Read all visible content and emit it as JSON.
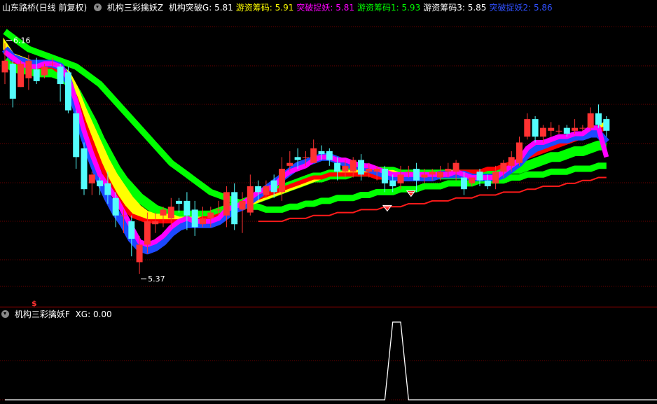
{
  "main_header": {
    "symbol": "山东路桥(日线 前复权)",
    "indicator": "机构三彩擒妖Z",
    "items": [
      {
        "label": "机构突破G:",
        "value": "5.81",
        "color": "#ffffff"
      },
      {
        "label": "游资筹码:",
        "value": "5.91",
        "color": "#ffff00"
      },
      {
        "label": "突破捉妖:",
        "value": "5.81",
        "color": "#ff00ff"
      },
      {
        "label": "游资筹码1:",
        "value": "5.93",
        "color": "#00ff00"
      },
      {
        "label": "游资筹码3:",
        "value": "5.85",
        "color": "#ffffff"
      },
      {
        "label": "突破捉妖2:",
        "value": "5.86",
        "color": "#3050ff"
      }
    ]
  },
  "sub_header": {
    "indicator": "机构三彩擒妖F",
    "items": [
      {
        "label": "XG:",
        "value": "0.00",
        "color": "#ffffff"
      }
    ]
  },
  "annotations": {
    "high_label": "6.16",
    "low_label": "5.37",
    "marker_glyph": "$"
  },
  "colors": {
    "up": "#ff3232",
    "down": "#54fcfc",
    "grid": "#6e0000",
    "blue_band": "#1c49ff",
    "green_band": "#00ff00",
    "magenta": "#ff00ff",
    "yellow": "#ffff00",
    "red_band": "#ff0000",
    "red_line": "#ff1a1a",
    "signal": "#ffffff"
  },
  "chart_data": [
    {
      "type": "candlestick",
      "title": "山东路桥(日线 前复权)",
      "ylim": [
        5.3,
        6.3
      ],
      "grid": true,
      "candles": [
        [
          6.1,
          6.14,
          6.2,
          6.06
        ],
        [
          6.13,
          6.01,
          6.14,
          5.98
        ],
        [
          6.05,
          6.13,
          6.14,
          6.05
        ],
        [
          6.08,
          6.14,
          6.16,
          6.04
        ],
        [
          6.11,
          6.07,
          6.15,
          6.06
        ],
        [
          6.09,
          6.12,
          6.13,
          6.08
        ],
        [
          6.13,
          6.13,
          6.15,
          6.12
        ],
        [
          6.12,
          6.06,
          6.13,
          6.0
        ],
        [
          6.1,
          5.97,
          6.12,
          5.96
        ],
        [
          5.96,
          5.81,
          5.97,
          5.77
        ],
        [
          5.84,
          5.7,
          5.86,
          5.68
        ],
        [
          5.72,
          5.75,
          5.76,
          5.68
        ],
        [
          5.73,
          5.71,
          5.74,
          5.68
        ],
        [
          5.72,
          5.68,
          5.76,
          5.65
        ],
        [
          5.67,
          5.61,
          5.69,
          5.57
        ],
        [
          5.61,
          5.61,
          5.63,
          5.55
        ],
        [
          5.59,
          5.53,
          5.61,
          5.47
        ],
        [
          5.45,
          5.51,
          5.54,
          5.41
        ],
        [
          5.51,
          5.59,
          5.62,
          5.48
        ],
        [
          5.58,
          5.59,
          5.62,
          5.55
        ],
        [
          5.61,
          5.63,
          5.64,
          5.57
        ],
        [
          5.6,
          5.64,
          5.67,
          5.57
        ],
        [
          5.66,
          5.65,
          5.67,
          5.62
        ],
        [
          5.66,
          5.61,
          5.69,
          5.56
        ],
        [
          5.63,
          5.57,
          5.66,
          5.54
        ],
        [
          5.58,
          5.6,
          5.64,
          5.57
        ],
        [
          5.6,
          5.62,
          5.64,
          5.57
        ],
        [
          5.63,
          5.63,
          5.66,
          5.61
        ],
        [
          5.61,
          5.69,
          5.71,
          5.57
        ],
        [
          5.69,
          5.58,
          5.72,
          5.56
        ],
        [
          5.63,
          5.66,
          5.69,
          5.55
        ],
        [
          5.62,
          5.71,
          5.75,
          5.61
        ],
        [
          5.71,
          5.69,
          5.73,
          5.66
        ],
        [
          5.68,
          5.71,
          5.73,
          5.67
        ],
        [
          5.73,
          5.69,
          5.75,
          5.67
        ],
        [
          5.69,
          5.77,
          5.81,
          5.66
        ],
        [
          5.78,
          5.79,
          5.83,
          5.76
        ],
        [
          5.81,
          5.8,
          5.84,
          5.77
        ],
        [
          5.81,
          5.81,
          5.83,
          5.78
        ],
        [
          5.79,
          5.84,
          5.87,
          5.79
        ],
        [
          5.83,
          5.82,
          5.85,
          5.8
        ],
        [
          5.83,
          5.8,
          5.84,
          5.78
        ],
        [
          5.79,
          5.76,
          5.81,
          5.73
        ],
        [
          5.76,
          5.78,
          5.8,
          5.74
        ],
        [
          5.76,
          5.8,
          5.81,
          5.74
        ],
        [
          5.8,
          5.75,
          5.82,
          5.73
        ],
        [
          5.76,
          5.77,
          5.79,
          5.74
        ],
        [
          5.76,
          5.77,
          5.78,
          5.73
        ],
        [
          5.77,
          5.72,
          5.78,
          5.69
        ],
        [
          5.73,
          5.71,
          5.75,
          5.69
        ],
        [
          5.72,
          5.75,
          5.78,
          5.7
        ],
        [
          5.76,
          5.76,
          5.78,
          5.74
        ],
        [
          5.77,
          5.73,
          5.79,
          5.69
        ],
        [
          5.74,
          5.75,
          5.77,
          5.72
        ],
        [
          5.75,
          5.76,
          5.77,
          5.73
        ],
        [
          5.74,
          5.76,
          5.78,
          5.73
        ],
        [
          5.76,
          5.77,
          5.79,
          5.74
        ],
        [
          5.76,
          5.79,
          5.8,
          5.73
        ],
        [
          5.74,
          5.7,
          5.76,
          5.68
        ],
        [
          5.72,
          5.74,
          5.74,
          5.71
        ],
        [
          5.76,
          5.73,
          5.77,
          5.71
        ],
        [
          5.73,
          5.71,
          5.75,
          5.7
        ],
        [
          5.72,
          5.76,
          5.78,
          5.7
        ],
        [
          5.76,
          5.79,
          5.8,
          5.74
        ],
        [
          5.78,
          5.81,
          5.83,
          5.76
        ],
        [
          5.79,
          5.86,
          5.88,
          5.78
        ],
        [
          5.88,
          5.94,
          5.96,
          5.87
        ],
        [
          5.94,
          5.88,
          5.95,
          5.86
        ],
        [
          5.88,
          5.91,
          5.92,
          5.86
        ],
        [
          5.9,
          5.91,
          5.93,
          5.88
        ],
        [
          5.9,
          5.9,
          5.92,
          5.89
        ],
        [
          5.91,
          5.89,
          5.92,
          5.88
        ],
        [
          5.9,
          5.91,
          5.94,
          5.89
        ],
        [
          5.91,
          5.91,
          5.92,
          5.9
        ],
        [
          5.91,
          5.96,
          5.98,
          5.9
        ],
        [
          5.96,
          5.92,
          5.99,
          5.91
        ],
        [
          5.94,
          5.9,
          5.95,
          5.88
        ]
      ],
      "series": [
        {
          "name": "机构突破G",
          "values": [
            6.24,
            6.22,
            6.2,
            6.18,
            6.17,
            6.16,
            6.15,
            6.14,
            6.13,
            6.12,
            6.1,
            6.08,
            6.06,
            6.03,
            6.0,
            5.97,
            5.94,
            5.91,
            5.88,
            5.85,
            5.82,
            5.79,
            5.77,
            5.75,
            5.73,
            5.71,
            5.69,
            5.68,
            5.67,
            5.66,
            5.65,
            5.64,
            5.64,
            5.63,
            5.63,
            5.63,
            5.64,
            5.64,
            5.65,
            5.65,
            5.66,
            5.66,
            5.67,
            5.67,
            5.67,
            5.68,
            5.68,
            5.69,
            5.69,
            5.69,
            5.7,
            5.7,
            5.7,
            5.71,
            5.71,
            5.71,
            5.72,
            5.72,
            5.72,
            5.72,
            5.73,
            5.73,
            5.73,
            5.73,
            5.74,
            5.74,
            5.75,
            5.75,
            5.75,
            5.76,
            5.76,
            5.76,
            5.77,
            5.77,
            5.77,
            5.78,
            5.78
          ]
        },
        {
          "name": "游资筹码1",
          "values": [
            6.2,
            6.16,
            6.15,
            6.14,
            6.13,
            6.13,
            6.13,
            6.12,
            6.1,
            6.05,
            5.98,
            5.92,
            5.86,
            5.8,
            5.75,
            5.71,
            5.67,
            5.64,
            5.62,
            5.61,
            5.61,
            5.61,
            5.6,
            5.6,
            5.6,
            5.6,
            5.6,
            5.61,
            5.62,
            5.63,
            5.64,
            5.65,
            5.66,
            5.67,
            5.68,
            5.69,
            5.7,
            5.71,
            5.72,
            5.73,
            5.74,
            5.75,
            5.75,
            5.76,
            5.76,
            5.76,
            5.76,
            5.76,
            5.76,
            5.76,
            5.75,
            5.75,
            5.75,
            5.75,
            5.75,
            5.75,
            5.76,
            5.76,
            5.76,
            5.76,
            5.76,
            5.77,
            5.77,
            5.78,
            5.79,
            5.8,
            5.82,
            5.83,
            5.84,
            5.85,
            5.86,
            5.87,
            5.88,
            5.89,
            5.9,
            5.91,
            5.93
          ]
        },
        {
          "name": "游资筹码",
          "values": [
            6.18,
            6.14,
            6.13,
            6.12,
            6.12,
            6.12,
            6.12,
            6.1,
            6.07,
            6.01,
            5.93,
            5.86,
            5.79,
            5.73,
            5.68,
            5.64,
            5.61,
            5.6,
            5.59,
            5.59,
            5.59,
            5.59,
            5.59,
            5.59,
            5.59,
            5.6,
            5.6,
            5.61,
            5.62,
            5.63,
            5.64,
            5.66,
            5.67,
            5.68,
            5.69,
            5.7,
            5.71,
            5.72,
            5.73,
            5.74,
            5.74,
            5.75,
            5.75,
            5.75,
            5.75,
            5.75,
            5.75,
            5.74,
            5.74,
            5.74,
            5.74,
            5.74,
            5.74,
            5.74,
            5.75,
            5.75,
            5.75,
            5.76,
            5.76,
            5.76,
            5.76,
            5.77,
            5.77,
            5.78,
            5.79,
            5.8,
            5.81,
            5.82,
            5.83,
            5.84,
            5.85,
            5.86,
            5.87,
            5.88,
            5.89,
            5.9,
            5.91
          ]
        },
        {
          "name": "游资筹码3",
          "values": [
            6.14,
            6.12,
            6.11,
            6.11,
            6.1,
            6.1,
            6.1,
            6.09,
            6.07,
            6.03,
            5.98,
            5.93,
            5.87,
            5.82,
            5.77,
            5.73,
            5.7,
            5.67,
            5.65,
            5.63,
            5.62,
            5.61,
            5.61,
            5.61,
            5.61,
            5.61,
            5.61,
            5.62,
            5.63,
            5.64,
            5.65,
            5.66,
            5.67,
            5.68,
            5.69,
            5.7,
            5.71,
            5.72,
            5.73,
            5.74,
            5.74,
            5.75,
            5.75,
            5.75,
            5.76,
            5.76,
            5.76,
            5.76,
            5.76,
            5.76,
            5.75,
            5.75,
            5.75,
            5.75,
            5.75,
            5.75,
            5.75,
            5.75,
            5.75,
            5.75,
            5.75,
            5.75,
            5.76,
            5.76,
            5.77,
            5.77,
            5.78,
            5.79,
            5.8,
            5.81,
            5.81,
            5.82,
            5.83,
            5.83,
            5.84,
            5.85,
            5.85
          ]
        },
        {
          "name": "突破捉妖",
          "values": [
            6.17,
            6.15,
            6.13,
            6.12,
            6.12,
            6.13,
            6.13,
            6.12,
            6.08,
            6.0,
            5.9,
            5.82,
            5.75,
            5.71,
            5.67,
            5.62,
            5.57,
            5.52,
            5.51,
            5.52,
            5.54,
            5.57,
            5.59,
            5.6,
            5.59,
            5.59,
            5.59,
            5.6,
            5.63,
            5.64,
            5.65,
            5.67,
            5.69,
            5.7,
            5.71,
            5.74,
            5.76,
            5.77,
            5.78,
            5.8,
            5.81,
            5.81,
            5.8,
            5.8,
            5.79,
            5.78,
            5.78,
            5.77,
            5.76,
            5.75,
            5.75,
            5.75,
            5.75,
            5.75,
            5.75,
            5.75,
            5.75,
            5.76,
            5.75,
            5.74,
            5.74,
            5.74,
            5.74,
            5.76,
            5.78,
            5.8,
            5.84,
            5.86,
            5.86,
            5.87,
            5.88,
            5.88,
            5.89,
            5.89,
            5.91,
            5.91,
            5.81
          ]
        },
        {
          "name": "突破捉妖2",
          "values": [
            6.18,
            6.15,
            6.14,
            6.13,
            6.13,
            6.13,
            6.13,
            6.12,
            6.07,
            5.98,
            5.88,
            5.8,
            5.73,
            5.67,
            5.62,
            5.58,
            5.53,
            5.5,
            5.49,
            5.5,
            5.52,
            5.55,
            5.57,
            5.58,
            5.58,
            5.58,
            5.58,
            5.59,
            5.61,
            5.63,
            5.64,
            5.66,
            5.68,
            5.7,
            5.72,
            5.74,
            5.76,
            5.78,
            5.79,
            5.8,
            5.81,
            5.81,
            5.8,
            5.79,
            5.78,
            5.78,
            5.77,
            5.76,
            5.75,
            5.74,
            5.74,
            5.74,
            5.74,
            5.74,
            5.74,
            5.75,
            5.75,
            5.75,
            5.75,
            5.74,
            5.74,
            5.74,
            5.74,
            5.75,
            5.77,
            5.79,
            5.82,
            5.84,
            5.85,
            5.86,
            5.87,
            5.87,
            5.88,
            5.88,
            5.89,
            5.89,
            5.86
          ]
        },
        {
          "name": "机构突破G_red",
          "values": [
            null,
            null,
            null,
            null,
            null,
            null,
            null,
            null,
            null,
            null,
            null,
            null,
            null,
            null,
            null,
            null,
            null,
            null,
            null,
            null,
            null,
            null,
            null,
            null,
            null,
            null,
            null,
            null,
            null,
            null,
            null,
            null,
            5.59,
            5.59,
            5.59,
            5.59,
            5.6,
            5.6,
            5.6,
            5.61,
            5.61,
            5.61,
            5.62,
            5.62,
            5.62,
            5.63,
            5.63,
            5.63,
            5.64,
            5.64,
            5.64,
            5.65,
            5.65,
            5.65,
            5.66,
            5.66,
            5.66,
            5.67,
            5.67,
            5.67,
            5.68,
            5.68,
            5.68,
            5.69,
            5.69,
            5.69,
            5.7,
            5.7,
            5.71,
            5.71,
            5.71,
            5.72,
            5.72,
            5.73,
            5.73,
            5.74,
            5.74
          ]
        }
      ],
      "signal_markers": [
        48,
        51
      ]
    },
    {
      "type": "line",
      "title": "机构三彩擒妖F",
      "series": [
        {
          "name": "XG",
          "values": [
            0,
            0,
            0,
            0,
            0,
            0,
            0,
            0,
            0,
            0,
            0,
            0,
            0,
            0,
            0,
            0,
            0,
            0,
            0,
            0,
            0,
            0,
            0,
            0,
            0,
            0,
            0,
            0,
            0,
            0,
            0,
            0,
            0,
            0,
            0,
            0,
            0,
            0,
            0,
            0,
            0,
            0,
            0,
            0,
            0,
            0,
            0,
            0,
            0,
            1,
            1,
            0,
            0,
            0,
            0,
            0,
            0,
            0,
            0,
            0,
            0,
            0,
            0,
            0,
            0,
            0,
            0,
            0,
            0,
            0,
            0,
            0,
            0,
            0,
            0,
            0,
            0
          ]
        }
      ],
      "ylim": [
        0,
        1
      ]
    }
  ]
}
